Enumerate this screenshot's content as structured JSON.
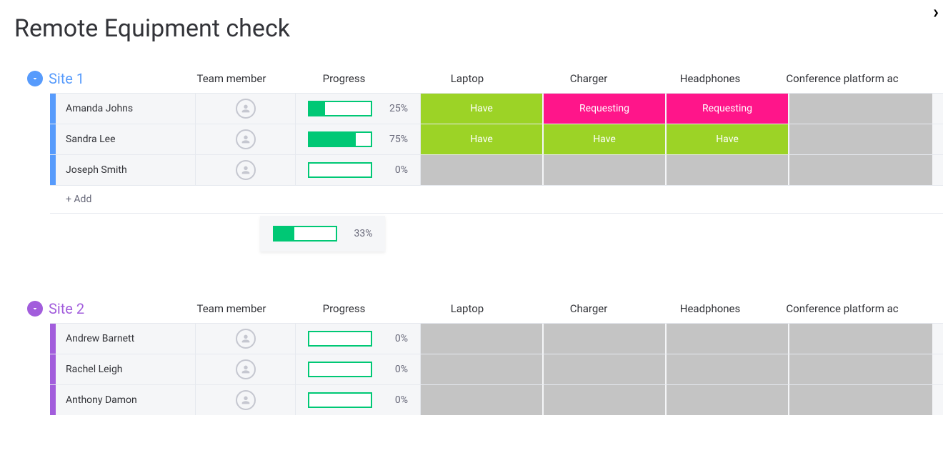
{
  "page": {
    "title": "Remote Equipment check"
  },
  "columns": {
    "team_member": "Team member",
    "progress": "Progress",
    "laptop": "Laptop",
    "charger": "Charger",
    "headphones": "Headphones",
    "conference": "Conference platform ac"
  },
  "status_labels": {
    "have": "Have",
    "requesting": "Requesting",
    "blank": ""
  },
  "add_label": "+ Add",
  "groups": [
    {
      "id": "site1",
      "title": "Site 1",
      "color": "blue",
      "summary_progress": 33,
      "rows": [
        {
          "name": "Amanda Johns",
          "progress": 25,
          "laptop": "have",
          "charger": "requesting",
          "headphones": "requesting",
          "conference": "blank"
        },
        {
          "name": "Sandra Lee",
          "progress": 75,
          "laptop": "have",
          "charger": "have",
          "headphones": "have",
          "conference": "blank"
        },
        {
          "name": "Joseph Smith",
          "progress": 0,
          "laptop": "blank",
          "charger": "blank",
          "headphones": "blank",
          "conference": "blank"
        }
      ]
    },
    {
      "id": "site2",
      "title": "Site 2",
      "color": "purple",
      "summary_progress": null,
      "rows": [
        {
          "name": "Andrew Barnett",
          "progress": 0,
          "laptop": "blank",
          "charger": "blank",
          "headphones": "blank",
          "conference": "blank"
        },
        {
          "name": "Rachel Leigh",
          "progress": 0,
          "laptop": "blank",
          "charger": "blank",
          "headphones": "blank",
          "conference": "blank"
        },
        {
          "name": "Anthony Damon",
          "progress": 0,
          "laptop": "blank",
          "charger": "blank",
          "headphones": "blank",
          "conference": "blank"
        }
      ]
    }
  ]
}
